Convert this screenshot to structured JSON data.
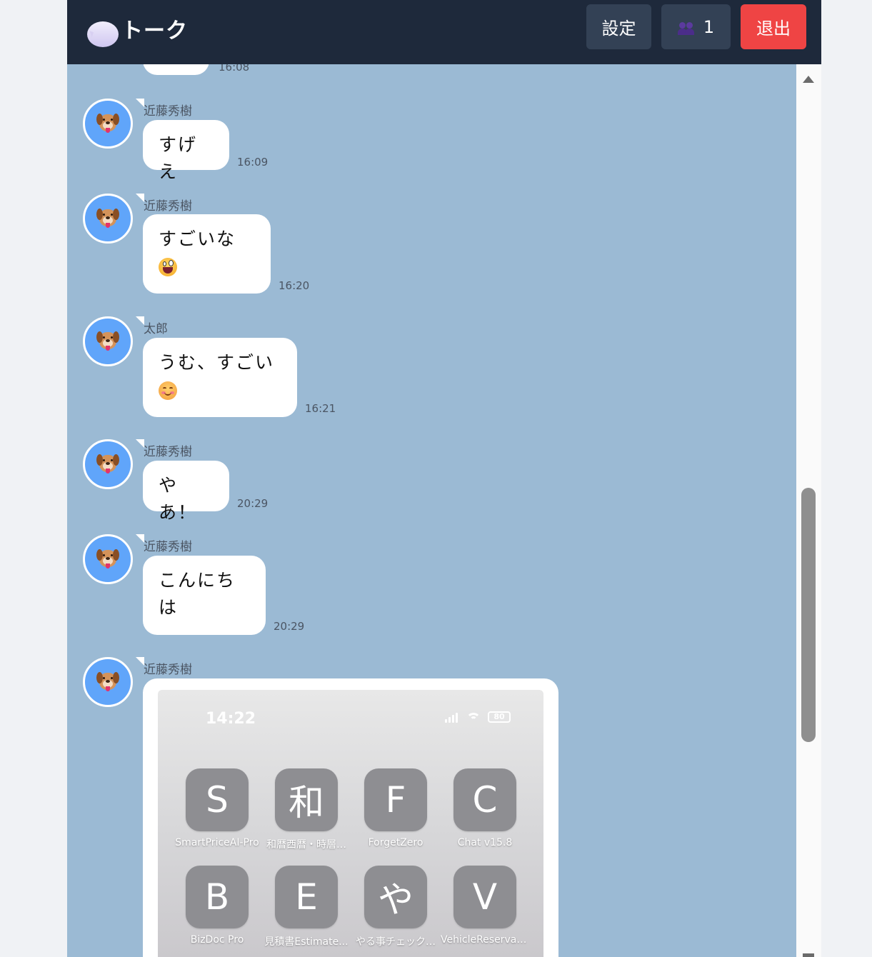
{
  "header": {
    "title": "トーク",
    "chat_icon": "speech-bubble-icon",
    "settings_label": "設定",
    "members_icon": "people-icon",
    "members_count": "1",
    "exit_label": "退出",
    "colors": {
      "header_bg": "#1e293b",
      "button_bg": "#334155",
      "exit_bg": "#ef4444"
    }
  },
  "chat": {
    "background": "#9bbad4",
    "previous_time": "16:08",
    "messages": [
      {
        "sender": "近藤秀樹",
        "lines": [
          "すげえ"
        ],
        "time": "16:09"
      },
      {
        "sender": "近藤秀樹",
        "lines": [
          "すごいな",
          ""
        ],
        "emoji": "grinning-face",
        "time": "16:20"
      },
      {
        "sender": "太郎",
        "lines": [
          "うむ、すごい",
          ""
        ],
        "emoji": "smiling-face",
        "time": "16:21"
      },
      {
        "sender": "近藤秀樹",
        "lines": [
          "やあ！"
        ],
        "time": "20:29"
      },
      {
        "sender": "近藤秀樹",
        "lines": [
          "こんにち",
          "は"
        ],
        "time": "20:29"
      },
      {
        "sender": "近藤秀樹",
        "type": "image"
      }
    ]
  },
  "screenshot": {
    "time": "14:22",
    "battery": "80",
    "apps": [
      {
        "letter": "S",
        "label": "SmartPriceAI-Pro"
      },
      {
        "letter": "和",
        "label": "和暦西暦・時層…"
      },
      {
        "letter": "F",
        "label": "ForgetZero"
      },
      {
        "letter": "C",
        "label": "Chat v15.8"
      },
      {
        "letter": "B",
        "label": "BizDoc Pro"
      },
      {
        "letter": "E",
        "label": "見積書Estimate..."
      },
      {
        "letter": "や",
        "label": "やる事チェック…"
      },
      {
        "letter": "V",
        "label": "VehicleReservat..."
      }
    ]
  }
}
